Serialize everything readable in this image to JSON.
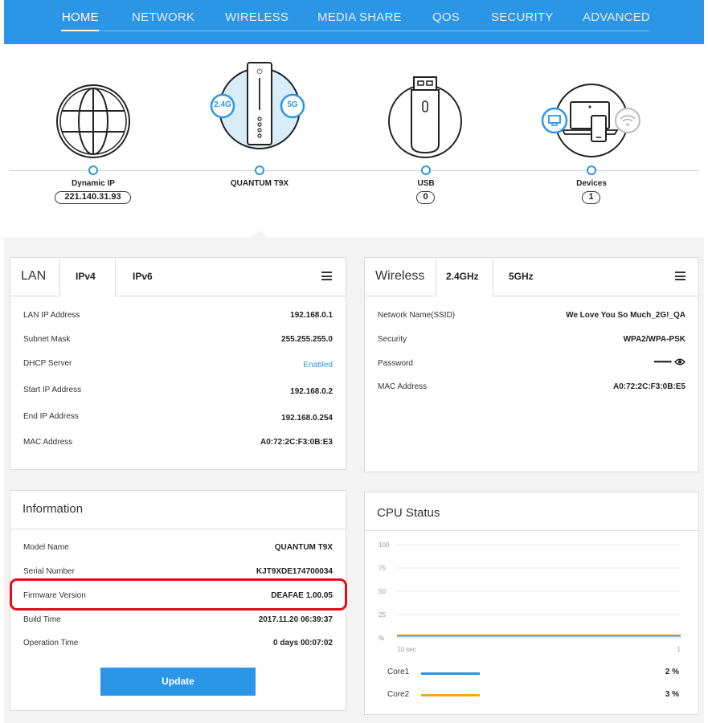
{
  "nav": {
    "items": [
      "HOME",
      "NETWORK",
      "WIRELESS",
      "MEDIA SHARE",
      "QOS",
      "SECURITY",
      "ADVANCED"
    ],
    "active": "HOME"
  },
  "topology": {
    "internet": {
      "label": "Dynamic IP",
      "value": "221.140.31.93"
    },
    "router": {
      "label": "QUANTUM T9X",
      "band1": "2.4G",
      "band2": "5G"
    },
    "usb": {
      "label": "USB",
      "value": "0"
    },
    "devices": {
      "label": "Devices",
      "value": "1"
    }
  },
  "lan": {
    "title": "LAN",
    "tabs": [
      "IPv4",
      "IPv6"
    ],
    "rows": [
      {
        "label": "LAN IP Address",
        "value": "192.168.0.1"
      },
      {
        "label": "Subnet Mask",
        "value": "255.255.255.0"
      },
      {
        "label": "DHCP Server",
        "value": "Enabled"
      },
      {
        "label": "Start IP Address",
        "value": "192.168.0.2"
      },
      {
        "label": "End IP Address",
        "value": "192.168.0.254"
      },
      {
        "label": "MAC Address",
        "value": "A0:72:2C:F3:0B:E3"
      }
    ]
  },
  "wireless": {
    "title": "Wireless",
    "tabs": [
      "2.4GHz",
      "5GHz"
    ],
    "rows": [
      {
        "label": "Network Name(SSID)",
        "value": "We Love You So Much_2G!_QA"
      },
      {
        "label": "Security",
        "value": "WPA2/WPA-PSK"
      },
      {
        "label": "Password",
        "value": "••••••••••"
      },
      {
        "label": "MAC Address",
        "value": "A0:72:2C:F3:0B:E5"
      }
    ]
  },
  "information": {
    "title": "Information",
    "rows": [
      {
        "label": "Model Name",
        "value": "QUANTUM T9X"
      },
      {
        "label": "Serial Number",
        "value": "KJT9XDE174700034"
      },
      {
        "label": "Firmware Version",
        "value": "DEAFAE 1.00.05"
      },
      {
        "label": "Build Time",
        "value": "2017.11.20 06:39:37"
      },
      {
        "label": "Operation Time",
        "value": "0 days 00:07:02"
      }
    ],
    "update_label": "Update"
  },
  "cpu": {
    "title": "CPU Status",
    "cores": [
      {
        "name": "Core1",
        "value": "2 %",
        "color": "#2c96e6"
      },
      {
        "name": "Core2",
        "value": "3 %",
        "color": "#f5a623"
      }
    ]
  },
  "chart_data": {
    "type": "line",
    "yticks": [
      "100",
      "75",
      "50",
      "25",
      "%"
    ],
    "xticks": [
      "10 sec",
      "1"
    ],
    "ylim": [
      0,
      100
    ],
    "series": [
      {
        "name": "Core1",
        "values": [
          2,
          2,
          2,
          2,
          2,
          2,
          2,
          2,
          2,
          2
        ],
        "color": "#2c96e6"
      },
      {
        "name": "Core2",
        "values": [
          3,
          3,
          3,
          3,
          3,
          3,
          3,
          3,
          3,
          3
        ],
        "color": "#f5a623"
      }
    ]
  },
  "colors": {
    "accent": "#2c96e6",
    "highlight": "#e0101a"
  }
}
